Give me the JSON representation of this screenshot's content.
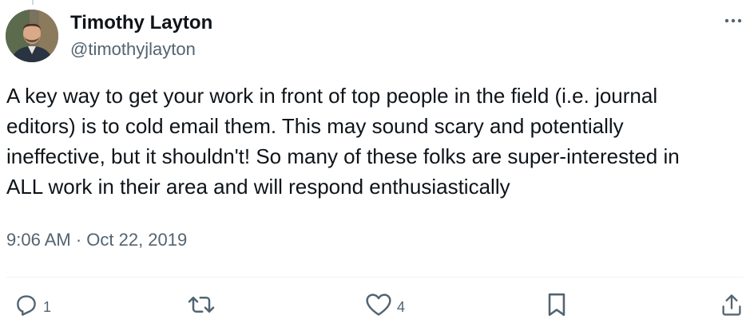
{
  "author": {
    "name": "Timothy Layton",
    "handle": "@timothyjlayton"
  },
  "tweet": {
    "lines": [
      "A key way to get your work in front of top people in the field (i.e. journal",
      "editors) is to cold email them. This may sound scary and potentially",
      "ineffective, but it shouldn't! So many of these folks are super-interested in",
      "ALL work in their area and will respond enthusiastically"
    ],
    "timestamp": "9:06 AM · Oct 22, 2019"
  },
  "actions": {
    "reply_count": "1",
    "like_count": "4"
  },
  "icons": {
    "more": "more-dots-icon",
    "reply": "reply-icon",
    "retweet": "retweet-icon",
    "like": "heart-icon",
    "bookmark": "bookmark-icon",
    "share": "share-icon"
  },
  "colors": {
    "text": "#0f1419",
    "secondary": "#536471",
    "divider": "#eff3f4"
  }
}
